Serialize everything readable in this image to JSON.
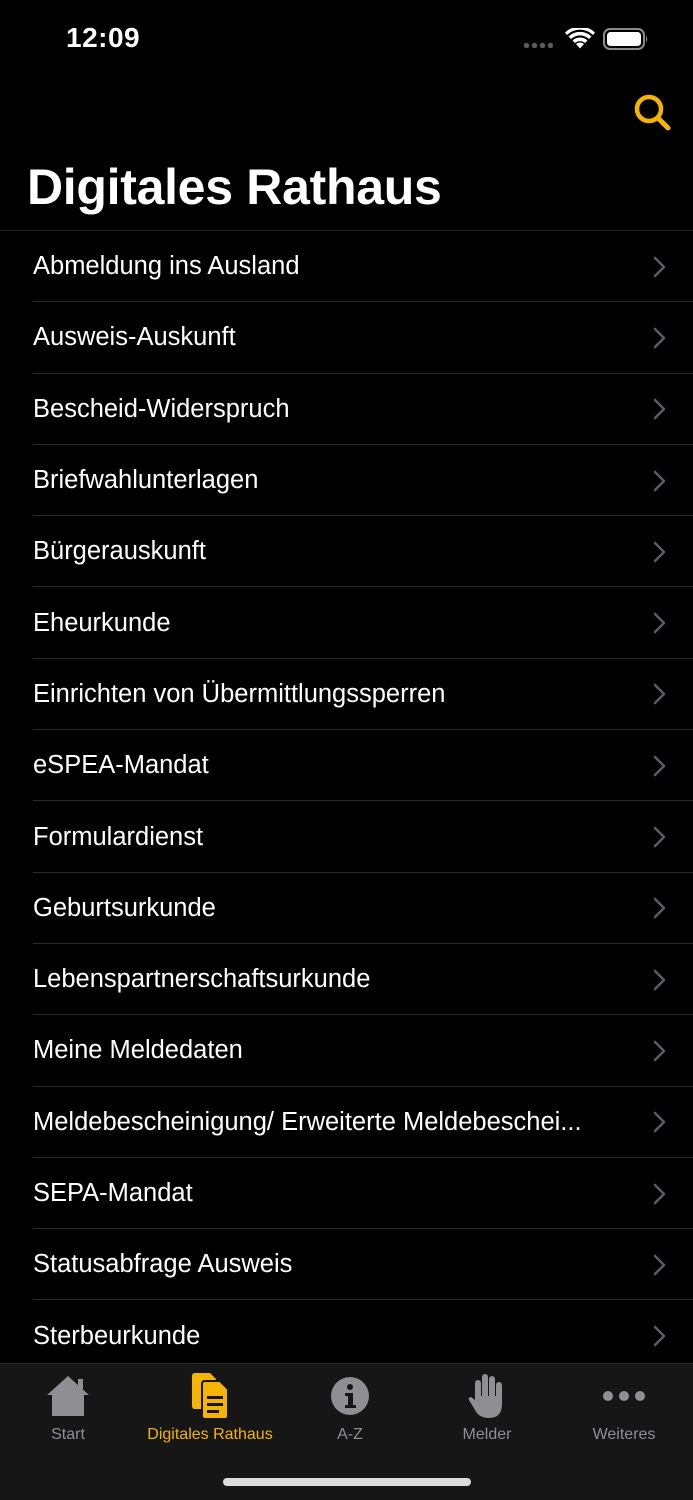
{
  "status_bar": {
    "time": "12:09"
  },
  "header": {
    "title": "Digitales Rathaus",
    "search_icon": "search-icon"
  },
  "colors": {
    "accent": "#F5B400",
    "background": "#000000",
    "inactive": "#8E8E93"
  },
  "list": {
    "items": [
      {
        "label": "Abmeldung ins Ausland"
      },
      {
        "label": "Ausweis-Auskunft"
      },
      {
        "label": "Bescheid-Widerspruch"
      },
      {
        "label": "Briefwahlunterlagen"
      },
      {
        "label": "Bürgerauskunft"
      },
      {
        "label": "Eheurkunde"
      },
      {
        "label": "Einrichten von Übermittlungssperren"
      },
      {
        "label": "eSPEA-Mandat"
      },
      {
        "label": "Formulardienst"
      },
      {
        "label": "Geburtsurkunde"
      },
      {
        "label": "Lebenspartnerschaftsurkunde"
      },
      {
        "label": "Meine Meldedaten"
      },
      {
        "label": "Meldebescheinigung/ Erweiterte Meldebeschei..."
      },
      {
        "label": "SEPA-Mandat"
      },
      {
        "label": "Statusabfrage Ausweis"
      },
      {
        "label": "Sterbeurkunde"
      }
    ]
  },
  "tab_bar": {
    "tabs": [
      {
        "label": "Start",
        "icon": "home-icon",
        "active": false
      },
      {
        "label": "Digitales Rathaus",
        "icon": "documents-icon",
        "active": true
      },
      {
        "label": "A-Z",
        "icon": "info-icon",
        "active": false
      },
      {
        "label": "Melder",
        "icon": "hand-icon",
        "active": false
      },
      {
        "label": "Weiteres",
        "icon": "more-icon",
        "active": false
      }
    ]
  }
}
